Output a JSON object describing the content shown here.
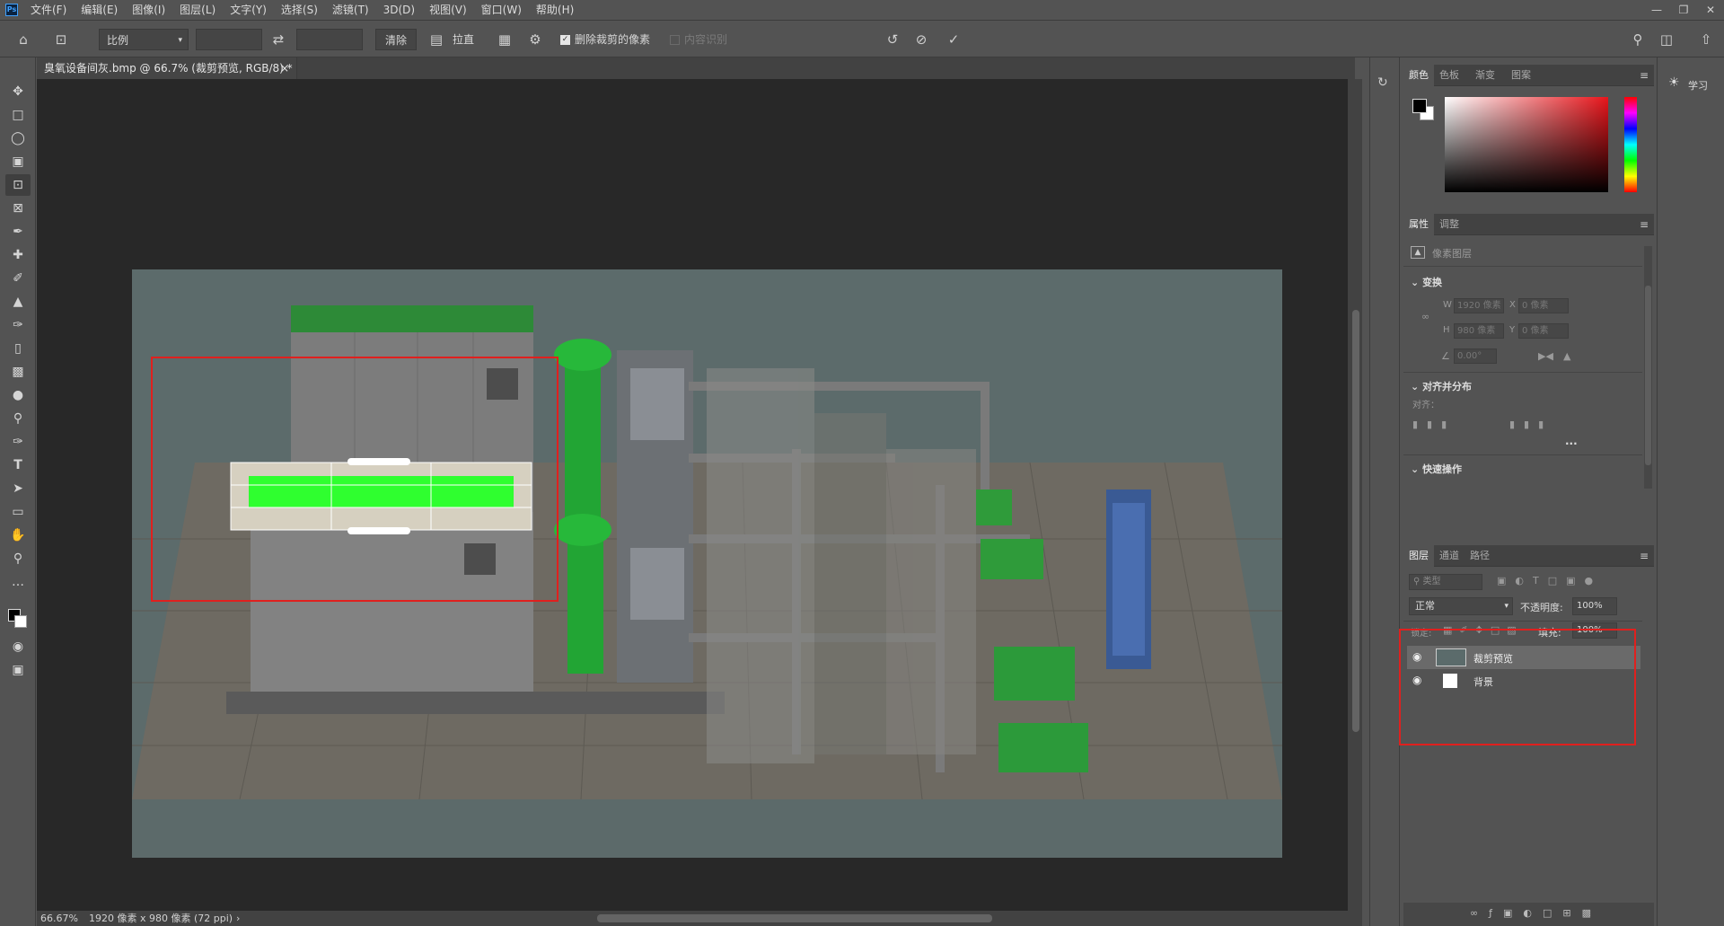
{
  "app": {
    "logo": "Ps"
  },
  "menu": [
    "文件(F)",
    "编辑(E)",
    "图像(I)",
    "图层(L)",
    "文字(Y)",
    "选择(S)",
    "滤镜(T)",
    "3D(D)",
    "视图(V)",
    "窗口(W)",
    "帮助(H)"
  ],
  "window_controls": [
    "minimize-icon",
    "restore-icon",
    "close-icon"
  ],
  "options": {
    "ratio_label": "比例",
    "width_value": "",
    "height_value": "",
    "clear_label": "清除",
    "straighten_label": "拉直",
    "delete_cropped_label": "删除裁剪的像素",
    "delete_cropped_checked": true,
    "content_aware_label": "内容识别",
    "content_aware_checked": false
  },
  "document": {
    "tab_title": "臭氧设备间灰.bmp @ 66.7% (裁剪预览, RGB/8) *",
    "zoom": "66.67%",
    "size_info": "1920 像素 x 980 像素 (72 ppi)"
  },
  "color_panel": {
    "tabs": [
      "颜色",
      "色板",
      "渐变",
      "图案"
    ],
    "active_tab": "颜色",
    "foreground": "#000000",
    "background": "#ffffff",
    "hue_color": "#e8151b"
  },
  "properties_panel": {
    "tabs": [
      "属性",
      "调整"
    ],
    "active_tab": "属性",
    "layer_kind": "像素图层",
    "transform_title": "变换",
    "w_value": "1920 像素",
    "h_value": "980 像素",
    "x_value": "0 像素",
    "y_value": "0 像素",
    "angle_value": "0.00°",
    "align_title": "对齐并分布",
    "align_label": "对齐：",
    "more": "...",
    "quick_title": "快速操作"
  },
  "layers_panel": {
    "tabs": [
      "图层",
      "通道",
      "路径"
    ],
    "active_tab": "图层",
    "filter_placeholder": "类型",
    "blend_mode": "正常",
    "opacity_label": "不透明度:",
    "opacity_value": "100%",
    "lock_label": "锁定:",
    "fill_label": "填充:",
    "fill_value": "100%",
    "layers": [
      {
        "name": "裁剪预览",
        "visible": true,
        "selected": true
      },
      {
        "name": "背景",
        "visible": true,
        "selected": false
      }
    ]
  },
  "learn_panel": {
    "label": "学习"
  },
  "accent_colors": {
    "highlight_red": "#e0201e",
    "panel_bg": "#535353",
    "canvas_bg": "#282828"
  }
}
